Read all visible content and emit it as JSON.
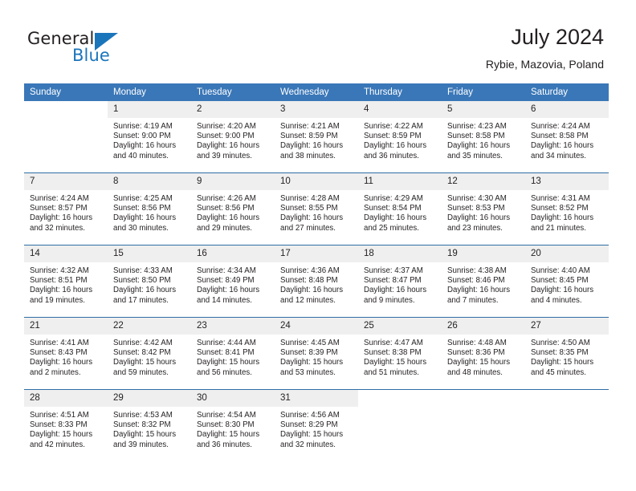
{
  "brand": {
    "name_part1": "General",
    "name_part2": "Blue",
    "triangle_icon": "logo-triangle-icon",
    "accent_color": "#1b75bb"
  },
  "header": {
    "title": "July 2024",
    "subtitle": "Rybie, Mazovia, Poland"
  },
  "theme": {
    "header_blue": "#3a77b8",
    "rule_blue": "#2e6da4",
    "daynum_band": "#efefef",
    "text": "#231f20"
  },
  "calendar": {
    "weekday_headers": [
      "Sunday",
      "Monday",
      "Tuesday",
      "Wednesday",
      "Thursday",
      "Friday",
      "Saturday"
    ],
    "weeks": [
      [
        {
          "day": "",
          "lines": []
        },
        {
          "day": "1",
          "lines": [
            "Sunrise: 4:19 AM",
            "Sunset: 9:00 PM",
            "Daylight: 16 hours",
            "and 40 minutes."
          ]
        },
        {
          "day": "2",
          "lines": [
            "Sunrise: 4:20 AM",
            "Sunset: 9:00 PM",
            "Daylight: 16 hours",
            "and 39 minutes."
          ]
        },
        {
          "day": "3",
          "lines": [
            "Sunrise: 4:21 AM",
            "Sunset: 8:59 PM",
            "Daylight: 16 hours",
            "and 38 minutes."
          ]
        },
        {
          "day": "4",
          "lines": [
            "Sunrise: 4:22 AM",
            "Sunset: 8:59 PM",
            "Daylight: 16 hours",
            "and 36 minutes."
          ]
        },
        {
          "day": "5",
          "lines": [
            "Sunrise: 4:23 AM",
            "Sunset: 8:58 PM",
            "Daylight: 16 hours",
            "and 35 minutes."
          ]
        },
        {
          "day": "6",
          "lines": [
            "Sunrise: 4:24 AM",
            "Sunset: 8:58 PM",
            "Daylight: 16 hours",
            "and 34 minutes."
          ]
        }
      ],
      [
        {
          "day": "7",
          "lines": [
            "Sunrise: 4:24 AM",
            "Sunset: 8:57 PM",
            "Daylight: 16 hours",
            "and 32 minutes."
          ]
        },
        {
          "day": "8",
          "lines": [
            "Sunrise: 4:25 AM",
            "Sunset: 8:56 PM",
            "Daylight: 16 hours",
            "and 30 minutes."
          ]
        },
        {
          "day": "9",
          "lines": [
            "Sunrise: 4:26 AM",
            "Sunset: 8:56 PM",
            "Daylight: 16 hours",
            "and 29 minutes."
          ]
        },
        {
          "day": "10",
          "lines": [
            "Sunrise: 4:28 AM",
            "Sunset: 8:55 PM",
            "Daylight: 16 hours",
            "and 27 minutes."
          ]
        },
        {
          "day": "11",
          "lines": [
            "Sunrise: 4:29 AM",
            "Sunset: 8:54 PM",
            "Daylight: 16 hours",
            "and 25 minutes."
          ]
        },
        {
          "day": "12",
          "lines": [
            "Sunrise: 4:30 AM",
            "Sunset: 8:53 PM",
            "Daylight: 16 hours",
            "and 23 minutes."
          ]
        },
        {
          "day": "13",
          "lines": [
            "Sunrise: 4:31 AM",
            "Sunset: 8:52 PM",
            "Daylight: 16 hours",
            "and 21 minutes."
          ]
        }
      ],
      [
        {
          "day": "14",
          "lines": [
            "Sunrise: 4:32 AM",
            "Sunset: 8:51 PM",
            "Daylight: 16 hours",
            "and 19 minutes."
          ]
        },
        {
          "day": "15",
          "lines": [
            "Sunrise: 4:33 AM",
            "Sunset: 8:50 PM",
            "Daylight: 16 hours",
            "and 17 minutes."
          ]
        },
        {
          "day": "16",
          "lines": [
            "Sunrise: 4:34 AM",
            "Sunset: 8:49 PM",
            "Daylight: 16 hours",
            "and 14 minutes."
          ]
        },
        {
          "day": "17",
          "lines": [
            "Sunrise: 4:36 AM",
            "Sunset: 8:48 PM",
            "Daylight: 16 hours",
            "and 12 minutes."
          ]
        },
        {
          "day": "18",
          "lines": [
            "Sunrise: 4:37 AM",
            "Sunset: 8:47 PM",
            "Daylight: 16 hours",
            "and 9 minutes."
          ]
        },
        {
          "day": "19",
          "lines": [
            "Sunrise: 4:38 AM",
            "Sunset: 8:46 PM",
            "Daylight: 16 hours",
            "and 7 minutes."
          ]
        },
        {
          "day": "20",
          "lines": [
            "Sunrise: 4:40 AM",
            "Sunset: 8:45 PM",
            "Daylight: 16 hours",
            "and 4 minutes."
          ]
        }
      ],
      [
        {
          "day": "21",
          "lines": [
            "Sunrise: 4:41 AM",
            "Sunset: 8:43 PM",
            "Daylight: 16 hours",
            "and 2 minutes."
          ]
        },
        {
          "day": "22",
          "lines": [
            "Sunrise: 4:42 AM",
            "Sunset: 8:42 PM",
            "Daylight: 15 hours",
            "and 59 minutes."
          ]
        },
        {
          "day": "23",
          "lines": [
            "Sunrise: 4:44 AM",
            "Sunset: 8:41 PM",
            "Daylight: 15 hours",
            "and 56 minutes."
          ]
        },
        {
          "day": "24",
          "lines": [
            "Sunrise: 4:45 AM",
            "Sunset: 8:39 PM",
            "Daylight: 15 hours",
            "and 53 minutes."
          ]
        },
        {
          "day": "25",
          "lines": [
            "Sunrise: 4:47 AM",
            "Sunset: 8:38 PM",
            "Daylight: 15 hours",
            "and 51 minutes."
          ]
        },
        {
          "day": "26",
          "lines": [
            "Sunrise: 4:48 AM",
            "Sunset: 8:36 PM",
            "Daylight: 15 hours",
            "and 48 minutes."
          ]
        },
        {
          "day": "27",
          "lines": [
            "Sunrise: 4:50 AM",
            "Sunset: 8:35 PM",
            "Daylight: 15 hours",
            "and 45 minutes."
          ]
        }
      ],
      [
        {
          "day": "28",
          "lines": [
            "Sunrise: 4:51 AM",
            "Sunset: 8:33 PM",
            "Daylight: 15 hours",
            "and 42 minutes."
          ]
        },
        {
          "day": "29",
          "lines": [
            "Sunrise: 4:53 AM",
            "Sunset: 8:32 PM",
            "Daylight: 15 hours",
            "and 39 minutes."
          ]
        },
        {
          "day": "30",
          "lines": [
            "Sunrise: 4:54 AM",
            "Sunset: 8:30 PM",
            "Daylight: 15 hours",
            "and 36 minutes."
          ]
        },
        {
          "day": "31",
          "lines": [
            "Sunrise: 4:56 AM",
            "Sunset: 8:29 PM",
            "Daylight: 15 hours",
            "and 32 minutes."
          ]
        },
        {
          "day": "",
          "lines": []
        },
        {
          "day": "",
          "lines": []
        },
        {
          "day": "",
          "lines": []
        }
      ]
    ]
  }
}
